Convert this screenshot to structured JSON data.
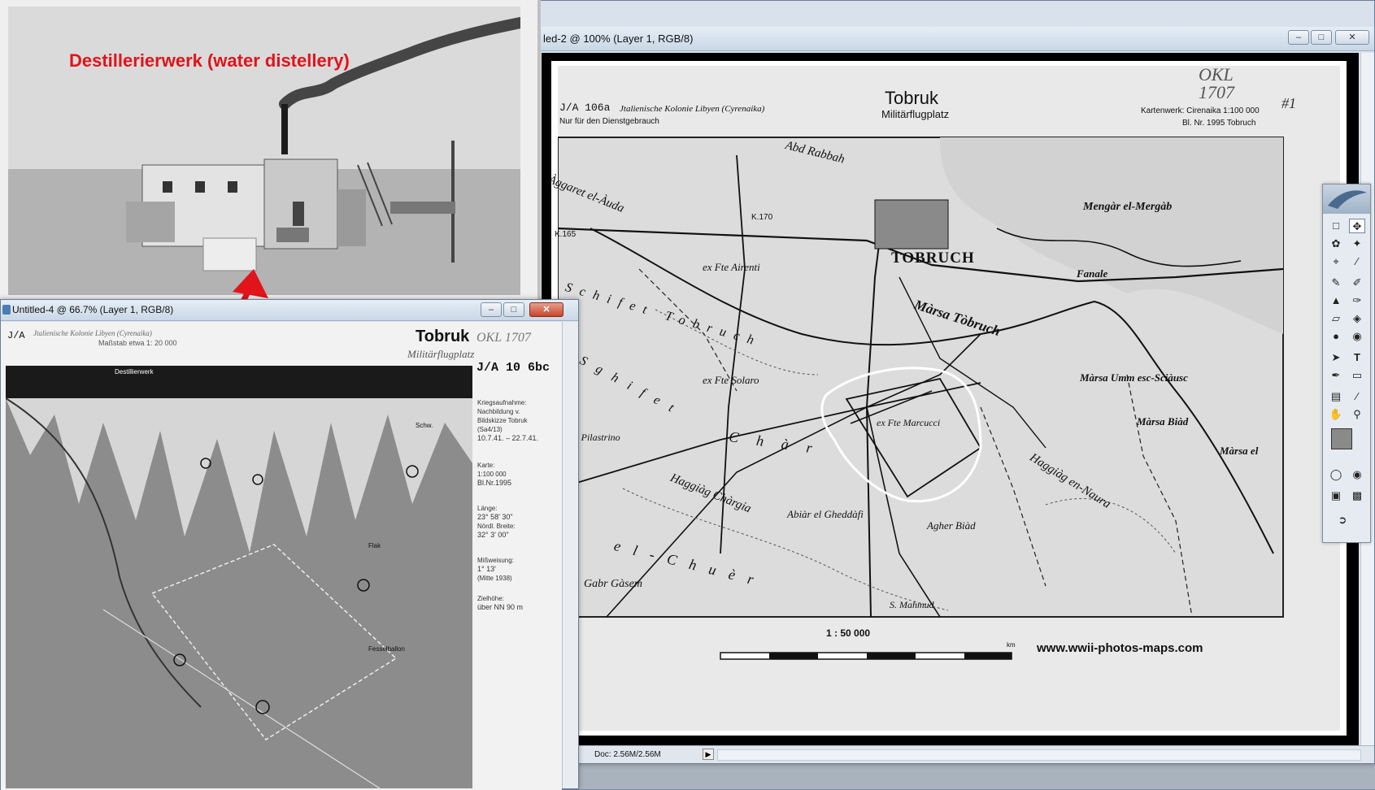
{
  "photo": {
    "caption": "Destillerierwerk (water distellery)"
  },
  "right_window": {
    "title": "led-2 @ 100% (Layer 1, RGB/8)",
    "minimize": "–",
    "maximize": "□",
    "close": "✕",
    "status_doc": "Doc: 2.56M/2.56M",
    "status_arrow": "▶"
  },
  "left_window": {
    "title": "Untitled-4 @ 66.7% (Layer 1, RGB/8)",
    "minimize": "–",
    "maximize": "□",
    "close": "✕"
  },
  "map": {
    "sheet_id": "J/A 106a",
    "colony": "Jtalienische Kolonie Libyen (Cyrenaika)",
    "restriction": "Nur für den Dienstgebrauch",
    "title": "Tobruk",
    "subtitle": "Militärflugplatz",
    "okl": "OKL 1707",
    "okl_num": "#1",
    "kartenwerk": "Kartenwerk: Cirenaika 1:100 000",
    "blatt": "Bl. Nr. 1995 Tobruch",
    "places": {
      "mengar": "Mengàr el-Mergàb",
      "tobruch": "TOBRUCH",
      "fanale": "Fanale",
      "marsa_tobruch": "Màrsa Tòbruch",
      "abd_rabbah": "Abd Rabbah",
      "aggaret": "Àggaret el-Àuda",
      "airenti": "ex Fte Airenti",
      "schifet": "Schifet Tobruch",
      "solaro": "ex Fte Solaro",
      "pilastrino": "ex Fte Pilastrino",
      "marcucci": "ex Fte Marcucci",
      "char": "Chàr",
      "sghifet": "Sghifet",
      "marsa_umm": "Màrsa Umm esc-Sciàusc",
      "marsa_biad": "Màrsa Biàd",
      "marsa_el": "Màrsa el",
      "haggiag_chargia": "Haggiàg Chàrgia",
      "abiar": "Abiàr el Gheddàfi",
      "agher_biad": "Agher Biàd",
      "el_chuer": "el-Chuèr",
      "gabr_gasem": "Gabr Gàsem",
      "s_mahmud": "S. Mahmud",
      "haggiag_naura": "Haggiàg en-Naura",
      "k165": "K.165",
      "k170": "K.170"
    },
    "scale_label": "1 : 50 000",
    "scale_km": "km",
    "website": "www.wwii-photos-maps.com"
  },
  "aerial": {
    "sheet": "J/A 10 6bc",
    "title": "Tobruk",
    "subtitle": "Militärflugplatz",
    "okl": "OKL 1707",
    "header_small": "Jtalienische Kolonie Libyen (Cyrenaika)",
    "massstab": "Maßstab etwa 1: 20 000",
    "distill_label": "Destillierwerk",
    "side": {
      "aufnahme": "Kriegsaufnahme:",
      "nachbildung": "Nachbildung v. Bildskizze Tobruk (Sa4/13)",
      "dates": "10.7.41. – 22.7.41.",
      "karte": "Karte:",
      "karte_val": "1:100 000",
      "blnr": "Bl.Nr.1995",
      "laenge": "Länge:",
      "laenge_val": "23° 58' 30\"",
      "breite": "Nördl. Breite:",
      "breite_val": "32° 3' 00\"",
      "missweisung": "Mißweisung:",
      "missweisung_val": "1° 13'",
      "mitte": "(Mitte 1938)",
      "zielhoehe": "Zielhöhe:",
      "zielhoehe_val": "über NN 90 m"
    },
    "labels": {
      "fesselballon": "Fesselballon",
      "flak": "Flak",
      "schw": "Schw."
    }
  }
}
